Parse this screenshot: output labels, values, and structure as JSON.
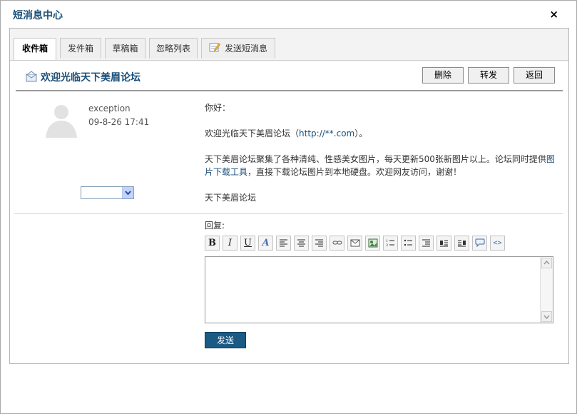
{
  "window": {
    "title": "短消息中心",
    "close_label": "×"
  },
  "tabs": [
    {
      "label": "收件箱"
    },
    {
      "label": "发件箱"
    },
    {
      "label": "草稿箱"
    },
    {
      "label": "忽略列表"
    },
    {
      "label": "发送短消息"
    }
  ],
  "message": {
    "title": "欢迎光临天下美眉论坛",
    "actions": {
      "delete": "删除",
      "forward": "转发",
      "back": "返回"
    },
    "sender": {
      "name": "exception",
      "time": "09-8-26 17:41"
    },
    "select_value": "",
    "body": {
      "greeting": "你好：",
      "line1_text": "欢迎光临天下美眉论坛（",
      "line1_link": "http://**.com",
      "line1_end": "）。",
      "line2_text": "天下美眉论坛聚集了各种清纯、性感美女图片，每天更新500张新图片以上。论坛同时提供",
      "line2_link": "图片下载工具",
      "line2_end": "，直接下载论坛图片到本地硬盘。欢迎网友访问，谢谢！",
      "signature": "天下美眉论坛"
    }
  },
  "reply": {
    "label": "回复:",
    "toolbar": [
      "bold-icon",
      "italic-icon",
      "underline-icon",
      "font-color-icon",
      "align-left-icon",
      "align-center-icon",
      "align-right-icon",
      "link-icon",
      "email-icon",
      "image-icon",
      "ordered-list-icon",
      "unordered-list-icon",
      "outdent-icon",
      "indent-left-icon",
      "indent-right-icon",
      "quote-icon",
      "code-icon"
    ],
    "toolbar_text": {
      "bold": "B",
      "italic": "I",
      "underline": "U",
      "font": "A"
    },
    "textarea_value": "",
    "send_label": "发送"
  },
  "colors": {
    "accent": "#1b4f79",
    "send_button": "#1b5a84"
  }
}
